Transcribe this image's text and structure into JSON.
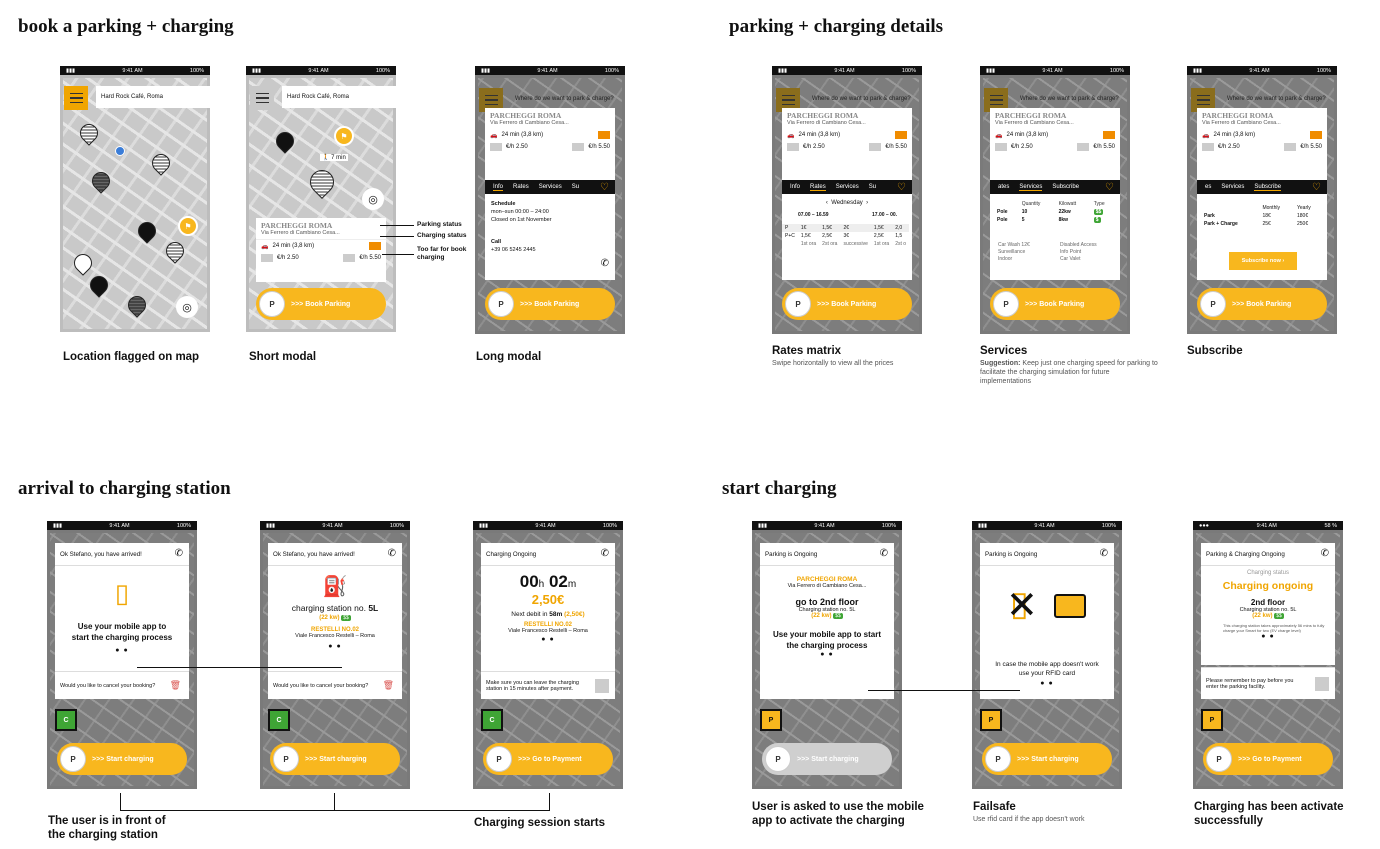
{
  "sections": {
    "book": "book a parking + charging",
    "details": "parking + charging details",
    "arrival": "arrival to charging station",
    "start": "start charging"
  },
  "status": {
    "time": "9:41 AM",
    "battery": "100%",
    "battery2": "58 %"
  },
  "places": {
    "hard_rock": "Hard Rock Café, Roma",
    "question": "Where do we want to park & charge?"
  },
  "parking": {
    "name": "PARCHEGGI ROMA",
    "address": "Via Ferrero di Cambiano Cesa...",
    "drive": "24 min (3,8 km)",
    "price1": "€/h 2.50",
    "price2": "€/h 5.50",
    "walk": "7 min"
  },
  "annotations": {
    "parking_status": "Parking status",
    "charging_status": "Charging status",
    "too_far": "Too far for book charging"
  },
  "tabs": {
    "info": [
      "Info",
      "Rates",
      "Services",
      "Su"
    ],
    "rates": [
      "Info",
      "Rates",
      "Services",
      "Su"
    ],
    "services": [
      "ates",
      "Services",
      "Subscribe"
    ],
    "subscribe": [
      "es",
      "Services",
      "Subscribe"
    ]
  },
  "info_tab": {
    "schedule": "Schedule",
    "hours": "mon–sun 00:00 – 24:00",
    "closed": "Closed on 1st November",
    "call": "Call",
    "phone": "+39 06 5245 2445"
  },
  "rates_tab": {
    "day": "Wednesday",
    "slot1": "07.00 – 16.59",
    "slot2": "17.00 – 00.",
    "rows": [
      [
        "P",
        "1€",
        "1,5€",
        "2€",
        "1,5€",
        "2,0"
      ],
      [
        "P+C",
        "1,5€",
        "2,5€",
        "3€",
        "2,5€",
        "1,5"
      ]
    ],
    "foot": [
      "1st ora",
      "2st ora",
      "successive",
      "1st ora",
      "2st o"
    ]
  },
  "services_tab": {
    "cols": [
      "Quantity",
      "Kilowatt",
      "Type"
    ],
    "rows": [
      [
        "Pole",
        "10",
        "22kw",
        "$$"
      ],
      [
        "Pole",
        "5",
        "8kw",
        "$"
      ]
    ],
    "items": [
      "Car Wash 12€",
      "Disabled Access",
      "Surveillance",
      "Info Point",
      "Indoor",
      "Car Valet"
    ]
  },
  "subscribe_tab": {
    "cols": [
      "Monthly",
      "Yearly"
    ],
    "rows": [
      [
        "Park",
        "18€",
        "180€"
      ],
      [
        "Park + Charge",
        "25€",
        "250€"
      ]
    ],
    "button": "Subscribe now"
  },
  "buttons": {
    "book": ">>> Book Parking",
    "start": ">>> Start charging",
    "pay": ">>> Go to Payment"
  },
  "arrival": {
    "arrived": "Ok Stefano, you have arrived!",
    "use_app": "Use your mobile app to start the charging process",
    "cancel": "Would you like to cancel your booking?",
    "station": "charging station no.",
    "station_no": "5L",
    "kw": "(22 kw)",
    "kw_badge": "$$",
    "restelli": "RESTELLI NO.02",
    "restelli_addr": "Viale Francesco Restelli – Roma",
    "ongoing": "Charging Ongoing",
    "timer_h": "00",
    "timer_m": "02",
    "amount": "2,50€",
    "next_debit": "Next debit in",
    "next_min": "58m",
    "next_amt": "(2,50€)",
    "leave": "Make sure you can leave the charging station in 15 minutes after payment."
  },
  "start": {
    "parking_ongoing": "Parking is Ongoing",
    "go_to": "go to 2nd floor",
    "station_line": "Charging station no. 5L",
    "rfid": "In case the mobile app doesn't work use your RFID card",
    "pc_ongoing": "Parking & Charging Ongoing",
    "charging_status": "Charging status",
    "charging_ongoing": "Charging ongoing",
    "floor": "2nd floor",
    "info_note": "This charging station takes approximately 56 mins to fully charge your Smart for two (EV charge level)",
    "pay_before": "Please remember to pay before you enter the parking facility."
  },
  "captions": {
    "loc": "Location flagged on map",
    "short": "Short modal",
    "long": "Long modal",
    "rates": "Rates matrix",
    "rates_sub": "Swipe horizontally to view all the prices",
    "services": "Services",
    "services_sub_b": "Suggestion:",
    "services_sub": "Keep just one charging speed for parking to facilitate the charging simulation for future implementations",
    "subscribe": "Subscribe",
    "user_front": "The user is in front of the charging station",
    "session": "Charging session starts",
    "asked": "User is asked to use the mobile app to activate the charging",
    "failsafe": "Failsafe",
    "failsafe_sub": "Use rfid card if the app doesn't work",
    "activated": "Charging has been activate successfully"
  }
}
